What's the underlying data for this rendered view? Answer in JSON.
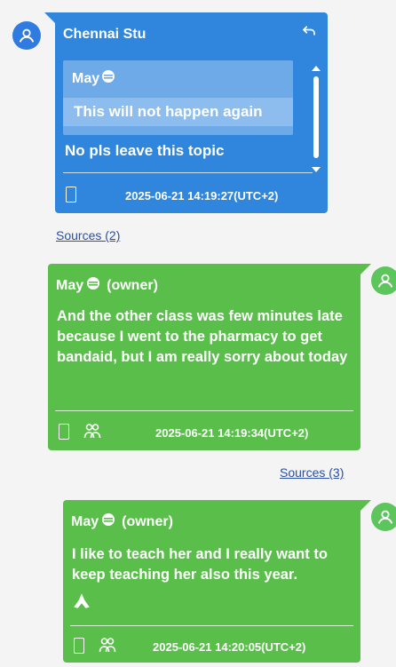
{
  "messages": [
    {
      "sender": "Chennai Stu",
      "quote": {
        "sender": "May",
        "text": "This will not happen again"
      },
      "body": "No pls leave this topic",
      "timestamp": "2025-06-21 14:19:27(UTC+2)",
      "sources_link": "Sources (2)"
    },
    {
      "sender": "May",
      "role": "(owner)",
      "body": "And the other class was few minutes late because I went to the pharmacy to get bandaid, but I am really sorry about today",
      "timestamp": "2025-06-21 14:19:34(UTC+2)",
      "sources_link": "Sources (3)"
    },
    {
      "sender": "May",
      "role": "(owner)",
      "body": "I like to teach her and I really want to keep teaching her also this year.",
      "timestamp": "2025-06-21 14:20:05(UTC+2)"
    }
  ],
  "colors": {
    "incoming": "#2f86dc",
    "outgoing": "#5abf4a",
    "link": "#2a4fa5"
  },
  "icons": [
    "user-avatar-icon",
    "reply-icon",
    "smiley-icon",
    "phone-icon",
    "people-icon",
    "praying-hands-icon"
  ]
}
